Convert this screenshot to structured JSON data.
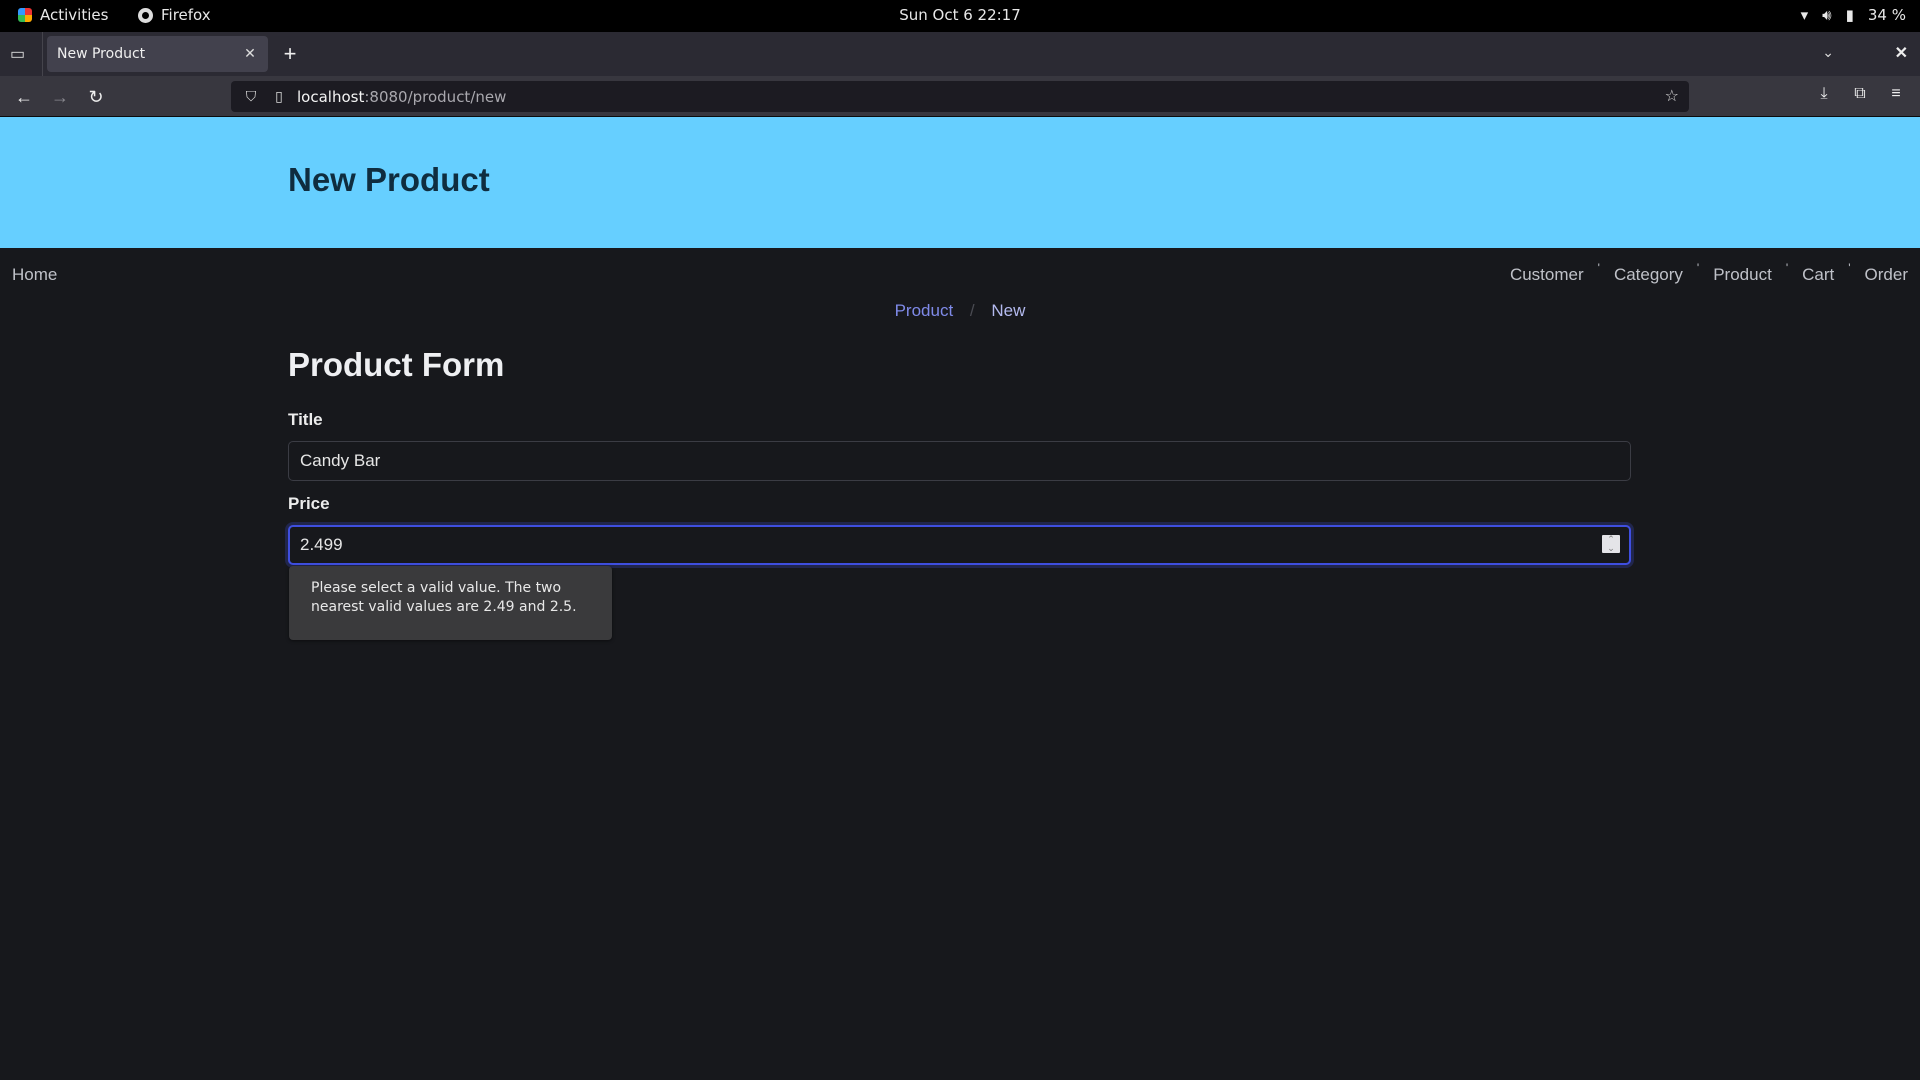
{
  "system": {
    "activities_label": "Activities",
    "app_name": "Firefox",
    "clock": "Sun Oct 6  22:17",
    "battery": "34 %"
  },
  "browser": {
    "tab_title": "New Product",
    "url_host": "localhost",
    "url_path": ":8080/product/new"
  },
  "header": {
    "title": "New Product",
    "background": "#66cfff"
  },
  "nav": {
    "home": "Home",
    "items": [
      "Customer",
      "Category",
      "Product",
      "Cart",
      "Order"
    ],
    "separator": "'"
  },
  "breadcrumb": {
    "parent": "Product",
    "divider": "/",
    "current": "New"
  },
  "form": {
    "title": "Product Form",
    "fields": [
      {
        "label": "Title",
        "value": "Candy Bar"
      },
      {
        "label": "Price",
        "value": "2.499"
      }
    ],
    "validation_message": "Please select a valid value. The two nearest valid values are 2.49 and 2.5."
  },
  "colors": {
    "accent_focus": "#3f4fe0",
    "breadcrumb_link": "#7f8ae8"
  }
}
